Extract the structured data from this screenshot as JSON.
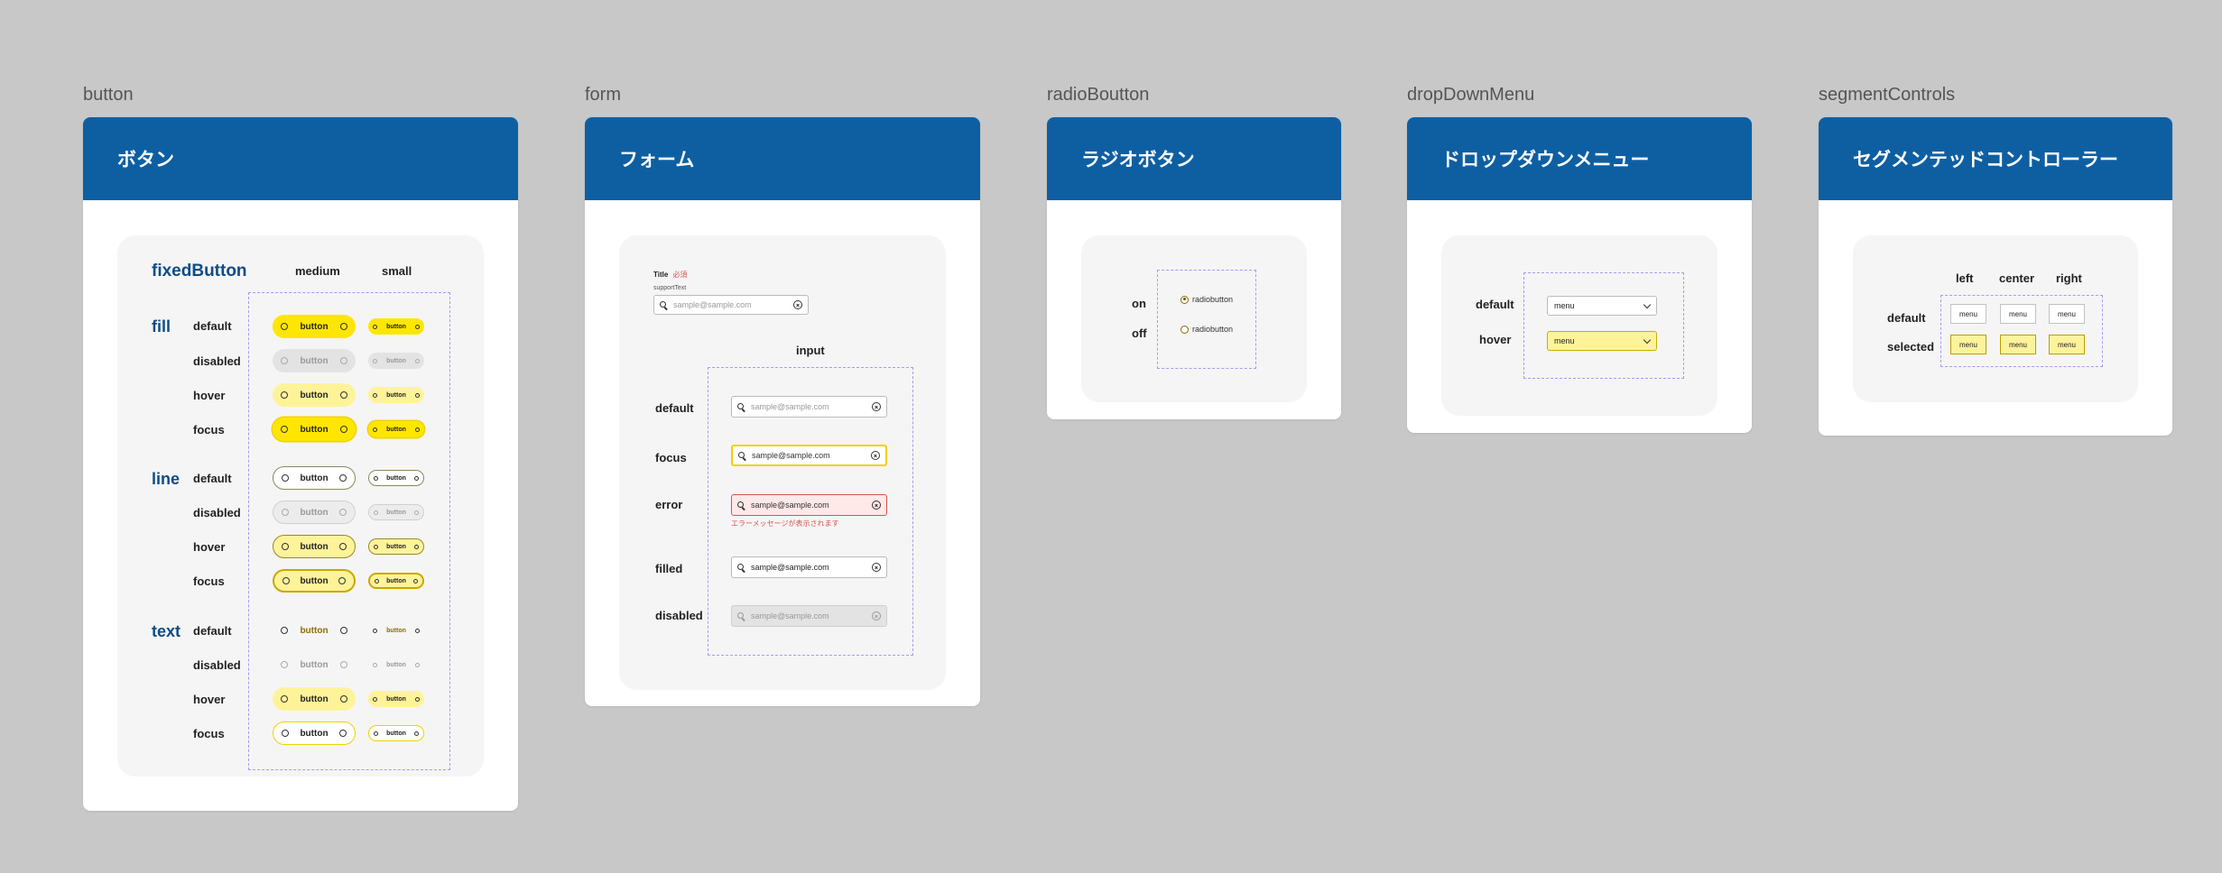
{
  "frames": {
    "button": "button",
    "form": "form",
    "radio": "radioBoutton",
    "dropdown": "dropDownMenu",
    "segment": "segmentControls"
  },
  "button_card": {
    "header": "ボタン",
    "fixed_title": "fixedButton",
    "col_medium": "medium",
    "col_small": "small",
    "groups": [
      "fill",
      "line",
      "text"
    ],
    "states": [
      "default",
      "disabled",
      "hover",
      "focus"
    ],
    "button_label": "button"
  },
  "form_card": {
    "header": "フォーム",
    "field_title": "Title",
    "required": "必須",
    "support_text": "supportText",
    "placeholder": "sample@sample.com",
    "input_head": "input",
    "states": [
      "default",
      "focus",
      "error",
      "filled",
      "disabled"
    ],
    "error_message": "エラーメッセージが表示されます"
  },
  "radio_card": {
    "header": "ラジオボタン",
    "states": [
      "on",
      "off"
    ],
    "label": "radiobutton"
  },
  "dropdown_card": {
    "header": "ドロップダウンメニュー",
    "states": [
      "default",
      "hover"
    ],
    "menu_label": "menu"
  },
  "segment_card": {
    "header": "セグメンテッドコントローラー",
    "cols": [
      "left",
      "center",
      "right"
    ],
    "states": [
      "default",
      "selected"
    ],
    "label": "menu"
  },
  "colors": {
    "header_blue": "#0e5fa2",
    "accent_yellow": "#ffe600",
    "hover_yellow": "#fff39a",
    "error_red": "#d9534f",
    "dashed_purple": "#a999ee"
  }
}
